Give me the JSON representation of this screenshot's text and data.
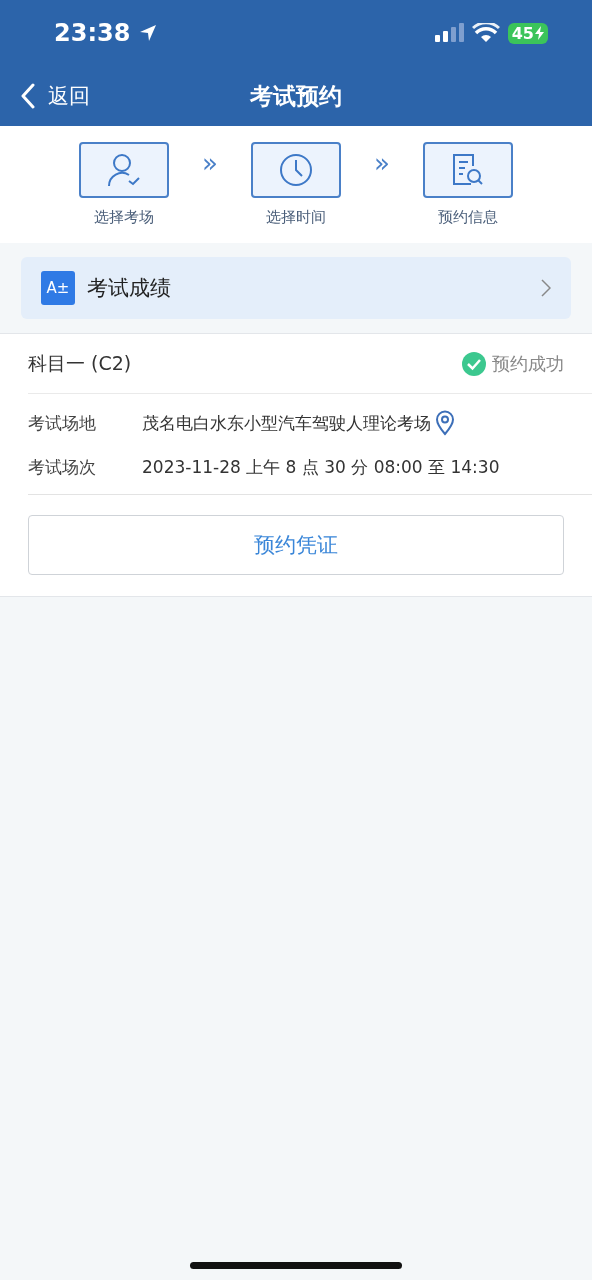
{
  "status_bar": {
    "time": "23:38",
    "battery": "45"
  },
  "nav": {
    "back": "返回",
    "title": "考试预约"
  },
  "steps": [
    {
      "kind": "person",
      "label": "选择考场"
    },
    {
      "kind": "clock",
      "label": "选择时间"
    },
    {
      "kind": "document",
      "label": "预约信息"
    }
  ],
  "step_separator": "»",
  "score_card": {
    "icon_text": "A±",
    "label": "考试成绩"
  },
  "booking": {
    "subject": "科目一 (C2)",
    "status": {
      "kind": "success",
      "label": "预约成功"
    },
    "fields": [
      {
        "label": "考试场地",
        "value": "茂名电白水东小型汽车驾驶人理论考场",
        "kind": "location"
      },
      {
        "label": "考试场次",
        "value": "2023-11-28 上午 8 点 30 分 08:00 至 14:30",
        "kind": "plain"
      }
    ],
    "button": "预约凭证"
  }
}
